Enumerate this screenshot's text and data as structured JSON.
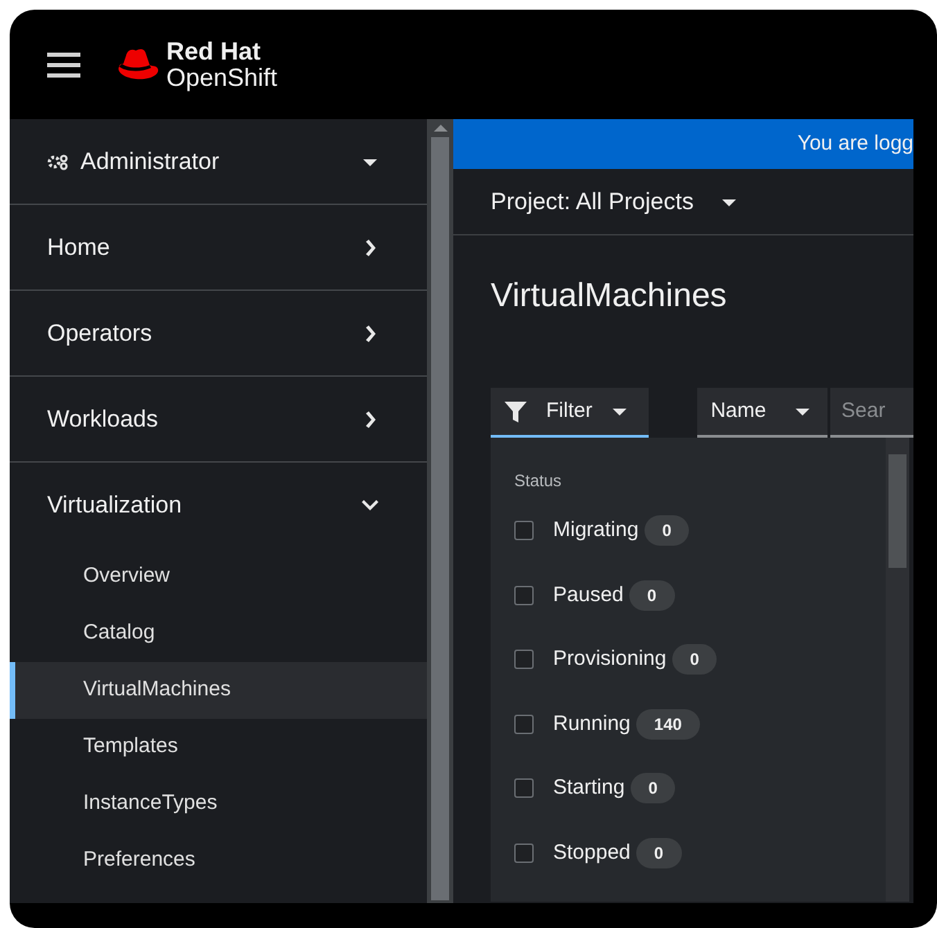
{
  "header": {
    "brand_top": "Red Hat",
    "brand_bottom": "OpenShift"
  },
  "sidebar": {
    "perspective": "Administrator",
    "sections": [
      {
        "label": "Home",
        "expanded": false
      },
      {
        "label": "Operators",
        "expanded": false
      },
      {
        "label": "Workloads",
        "expanded": false
      },
      {
        "label": "Virtualization",
        "expanded": true,
        "children": [
          {
            "label": "Overview",
            "selected": false
          },
          {
            "label": "Catalog",
            "selected": false
          },
          {
            "label": "VirtualMachines",
            "selected": true
          },
          {
            "label": "Templates",
            "selected": false
          },
          {
            "label": "InstanceTypes",
            "selected": false
          },
          {
            "label": "Preferences",
            "selected": false
          }
        ]
      }
    ]
  },
  "banner": "You are logg",
  "project": "Project: All Projects",
  "title": "VirtualMachines",
  "toolbar": {
    "filter": "Filter",
    "filter_open": true,
    "attribute": "Name",
    "search_placeholder": "Sear"
  },
  "filter_menu": {
    "group": "Status",
    "items": [
      {
        "label": "Migrating",
        "count": "0",
        "checked": false
      },
      {
        "label": "Paused",
        "count": "0",
        "checked": false
      },
      {
        "label": "Provisioning",
        "count": "0",
        "checked": false
      },
      {
        "label": "Running",
        "count": "140",
        "checked": false
      },
      {
        "label": "Starting",
        "count": "0",
        "checked": false
      },
      {
        "label": "Stopped",
        "count": "0",
        "checked": false
      }
    ]
  }
}
